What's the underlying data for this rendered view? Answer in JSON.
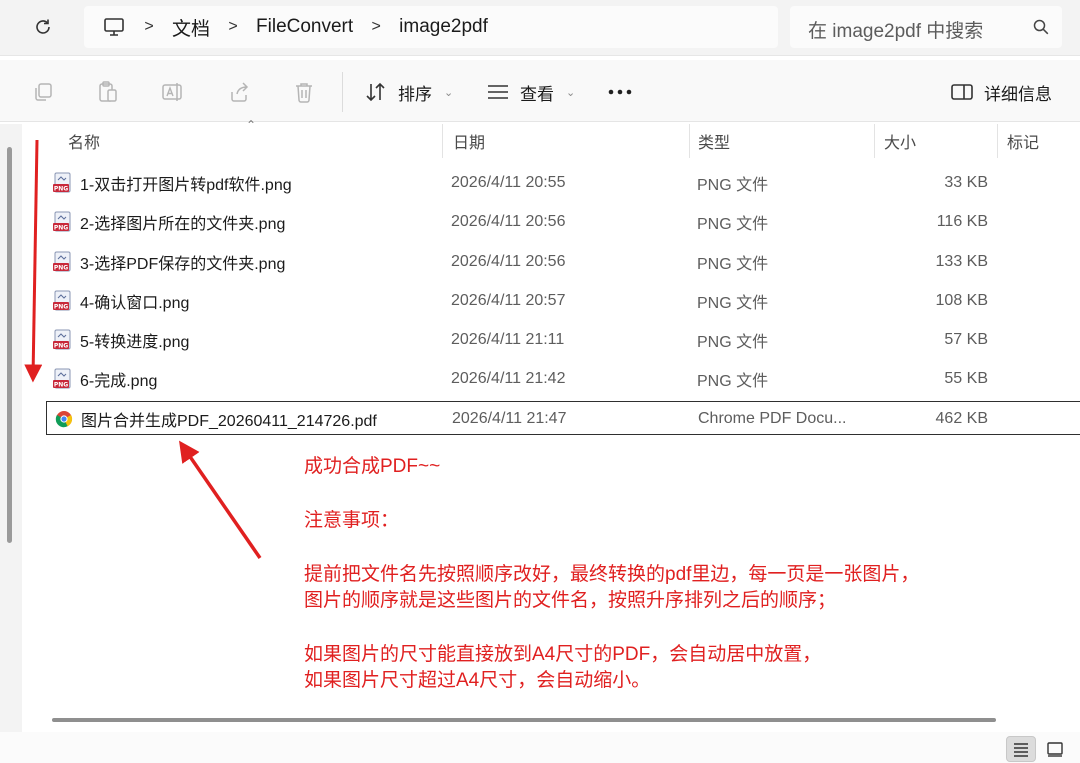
{
  "address": {
    "crumbs": [
      "文档",
      "FileConvert",
      "image2pdf"
    ],
    "search_placeholder": "在 image2pdf 中搜索"
  },
  "toolbar": {
    "sort_label": "排序",
    "view_label": "查看",
    "details_label": "详细信息",
    "icons": [
      "copy-icon",
      "paste-icon",
      "rename-icon",
      "share-icon",
      "delete-icon",
      "sort-icon",
      "view-icon",
      "more-icon",
      "details-pane-icon"
    ]
  },
  "columns": {
    "name": "名称",
    "date": "日期",
    "type": "类型",
    "size": "大小",
    "tags": "标记"
  },
  "files": [
    {
      "name": "1-双击打开图片转pdf软件.png",
      "date": "2026/4/11 20:55",
      "type": "PNG 文件",
      "size": "33 KB",
      "icon": "png-file-icon"
    },
    {
      "name": "2-选择图片所在的文件夹.png",
      "date": "2026/4/11 20:56",
      "type": "PNG 文件",
      "size": "116 KB",
      "icon": "png-file-icon"
    },
    {
      "name": "3-选择PDF保存的文件夹.png",
      "date": "2026/4/11 20:56",
      "type": "PNG 文件",
      "size": "133 KB",
      "icon": "png-file-icon"
    },
    {
      "name": "4-确认窗口.png",
      "date": "2026/4/11 20:57",
      "type": "PNG 文件",
      "size": "108 KB",
      "icon": "png-file-icon"
    },
    {
      "name": "5-转换进度.png",
      "date": "2026/4/11 21:11",
      "type": "PNG 文件",
      "size": "57 KB",
      "icon": "png-file-icon"
    },
    {
      "name": "6-完成.png",
      "date": "2026/4/11 21:42",
      "type": "PNG 文件",
      "size": "55 KB",
      "icon": "png-file-icon"
    },
    {
      "name": "图片合并生成PDF_20260411_214726.pdf",
      "date": "2026/4/11 21:47",
      "type": "Chrome PDF Docu...",
      "size": "462 KB",
      "icon": "chrome-pdf-icon",
      "selected": true
    }
  ],
  "annotation": {
    "line1": "成功合成PDF~~",
    "line2": "注意事项：",
    "line3": "提前把文件名先按照顺序改好，最终转换的pdf里边，每一页是一张图片，",
    "line4": "图片的顺序就是这些图片的文件名，按照升序排列之后的顺序；",
    "line5": "如果图片的尺寸能直接放到A4尺寸的PDF，会自动居中放置，",
    "line6": "如果图片尺寸超过A4尺寸，会自动缩小。",
    "color": "#e02020"
  },
  "status_icons": [
    "details-view-icon",
    "tiles-view-icon"
  ]
}
